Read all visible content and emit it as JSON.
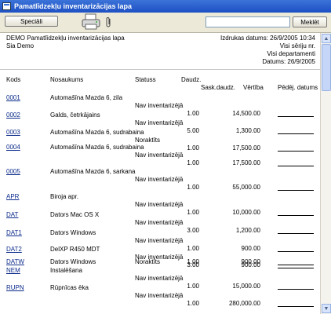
{
  "window": {
    "title": "Pamatlīdzekļu inventarizācijas lapa"
  },
  "toolbar": {
    "special_label": "Speciāli",
    "search_value": "",
    "search_button_label": "Meklēt",
    "icons": [
      "printer-icon",
      "paperclip-icon"
    ]
  },
  "report": {
    "title": "DEMO Pamatlīdzekļu inventarizācijas lapa",
    "company": "Sia Demo",
    "print_date": "Izdrukas datums: 26/9/2005 10:34",
    "series": "Visi sēriju nr.",
    "departments": "Visi departamenti",
    "date": "Datums: 26/9/2005"
  },
  "columns": {
    "code": "Kods",
    "name": "Nosaukums",
    "status": "Statuss",
    "qty": "Daudz.",
    "counted": "Sask.daudz.",
    "value": "Vērtība",
    "last_date": "Pēdēj. datums"
  },
  "rows": [
    {
      "code": "0001",
      "name": "Automašīna Mazda 6, zila",
      "status": "Nav inventarizējā",
      "qty": "1.00",
      "value": "14,500.00"
    },
    {
      "code": "0002",
      "name": "Galds, četrkājains",
      "status": "Nav inventarizējā",
      "qty": "5.00",
      "value": "1,300.00"
    },
    {
      "code": "0003",
      "name": "Automašīna Mazda 6, sudrabaina",
      "status": "Noraktīts",
      "qty": "1.00",
      "value": "17,500.00"
    },
    {
      "code": "0004",
      "name": "Automašīna Mazda 6, sudrabaina",
      "status": "Nav inventarizējā",
      "qty": "1.00",
      "value": "17,500.00"
    },
    {
      "code": "0005",
      "name": "Automašīna Mazda 6, sarkana",
      "status": "Nav inventarizējā",
      "qty": "1.00",
      "value": "55,000.00"
    },
    {
      "code": "APR",
      "name": "Biroja apr.",
      "status": "Nav inventarizējā",
      "qty": "1.00",
      "value": "10,000.00"
    },
    {
      "code": "DAT",
      "name": "Dators Mac OS X",
      "status": "Nav inventarizējā",
      "qty": "3.00",
      "value": "1,200.00"
    },
    {
      "code": "DAT1",
      "name": "Dators Windows",
      "status": "Nav inventarizējā",
      "qty": "1.00",
      "value": "900.00"
    },
    {
      "code": "DAT2",
      "name": "DelXP R450 MDT",
      "status": "Nav inventarizējā",
      "qty": "3.00",
      "value": "900.00"
    },
    {
      "code": "DATW",
      "name": "Dators Windows",
      "status": "Noraktīts",
      "qty": "1.00",
      "value": "900.00"
    },
    {
      "code": "NEM",
      "name": "Instalēšana",
      "status": "Nav inventarizējā",
      "qty": "1.00",
      "value": "15,000.00"
    },
    {
      "code": "RUPN",
      "name": "Rūpnīcas ēka",
      "status": "Nav inventarizējā",
      "qty": "1.00",
      "value": "280,000.00"
    }
  ]
}
